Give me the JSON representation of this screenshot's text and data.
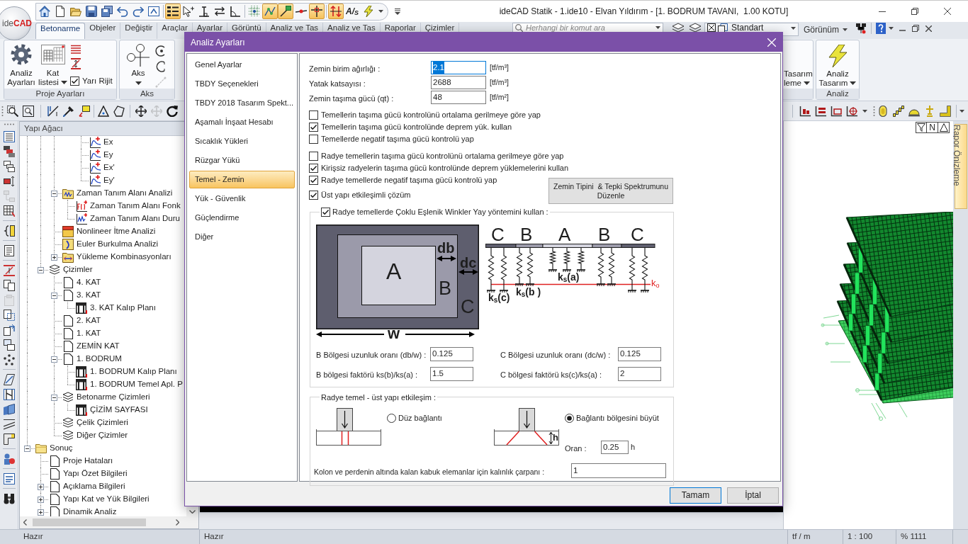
{
  "window": {
    "logo": "ide**CAD**",
    "title": "ideCAD Statik - 1.ide10 - Elvan Yıldırım - [1. BODRUM TAVANI,  1.00 KOTU]"
  },
  "quick_access_toolbar": [
    {
      "pressed": false
    },
    {
      "pressed": false
    },
    {
      "pressed": false
    },
    {
      "pressed": false
    },
    {
      "pressed": false
    },
    {
      "pressed": false
    },
    {
      "pressed": false
    },
    {
      "pressed": false
    },
    {
      "pressed": true
    },
    {
      "pressed": false
    },
    {
      "pressed": false
    },
    {
      "pressed": false
    },
    {
      "pressed": false
    },
    {
      "pressed": false
    },
    {
      "pressed": true
    },
    {
      "pressed": true
    },
    {
      "pressed": false
    },
    {
      "pressed": true
    },
    {
      "pressed": true
    },
    {
      "pressed": false,
      "label": "A/$_{S}$"
    },
    {
      "pressed": false
    }
  ],
  "ribbon": {
    "tabs": [
      {
        "label": "Betonarme",
        "selected": true
      },
      {
        "label": "Objeler",
        "selected": false
      },
      {
        "label": "Değiştir",
        "selected": false
      },
      {
        "label": "Araçlar",
        "selected": false
      },
      {
        "label": "Ayarlar",
        "selected": false
      },
      {
        "label": "Görüntü",
        "selected": false
      },
      {
        "label": "Analiz ve Tas",
        "selected": false
      },
      {
        "label": "Analiz ve Tas",
        "selected": false
      },
      {
        "label": "Raporlar",
        "selected": false
      },
      {
        "label": "Çizimler",
        "selected": false
      }
    ],
    "search": {
      "placeholder": "Herhangi bir komut ara"
    },
    "style_dropdown": "Standart",
    "view_dropdown": "Görünüm",
    "groups": [
      {
        "kind": "project",
        "label": "Proje Ayarları",
        "buttons": [
          {
            "label": "Analiz Ayarları",
            "dropdown": false
          },
          {
            "label": "Kat listesi",
            "dropdown": true
          }
        ],
        "options": [
          {
            "label": "Yarı Rijit",
            "checked": true
          }
        ]
      },
      {
        "kind": "axis",
        "label": "Aks",
        "buttons": [
          {
            "label": "Aks",
            "dropdown": true
          }
        ],
        "tools": [
          {
            "disabled": false
          },
          {
            "disabled": false
          },
          {
            "disabled": true
          }
        ]
      },
      {
        "kind": "partial",
        "buttons": [
          {
            "label": "Tasarım leme",
            "dropdown": true
          }
        ]
      },
      {
        "kind": "analysis",
        "label": "Analiz",
        "buttons": [
          {
            "label": "Analiz Tasarım",
            "dropdown": true
          }
        ]
      }
    ]
  },
  "view_toolbar": [
    {
      "disabled": false
    },
    {
      "disabled": false
    },
    {
      "disabled": false
    },
    {
      "disabled": false
    },
    {
      "disabled": false
    },
    {
      "disabled": false
    },
    {
      "disabled": false
    },
    {
      "disabled": false
    },
    {
      "disabled": true
    },
    {
      "disabled": false
    }
  ],
  "model_toolbar": [
    {
      "disabled": false
    },
    {
      "disabled": false
    },
    {
      "disabled": false
    },
    {
      "disabled": false
    },
    {
      "disabled": false
    },
    {
      "disabled": false
    },
    {
      "disabled": false
    },
    {
      "disabled": false
    },
    {
      "disabled": false
    }
  ],
  "side_toolbar": [
    {
      "disabled": false
    },
    {
      "disabled": false
    },
    {
      "disabled": false
    },
    {
      "disabled": false
    },
    {
      "disabled": true
    },
    {
      "disabled": false
    },
    {
      "disabled": false
    },
    {
      "disabled": false
    },
    {
      "disabled": false
    },
    {
      "disabled": false
    },
    {
      "disabled": true
    },
    {
      "disabled": false
    },
    {
      "disabled": false
    },
    {
      "disabled": false
    },
    {
      "disabled": false
    },
    {
      "disabled": false
    },
    {
      "disabled": false
    },
    {
      "disabled": false
    },
    {
      "disabled": false
    },
    {
      "disabled": false
    },
    {
      "disabled": false
    },
    {
      "disabled": false
    },
    {
      "disabled": false
    }
  ],
  "structure_tree": {
    "title": "Yapı Ağacı",
    "items": [
      {
        "children": [
          {
            "children": [
              {
                "children": [
                  {
                    "children": [
                      {
                        "label": "Ex",
                        "kind": "spectrum"
                      },
                      {
                        "label": "Ey",
                        "kind": "spectrum"
                      },
                      {
                        "label": "Ex'",
                        "kind": "spectrum"
                      },
                      {
                        "label": "Ey'",
                        "kind": "spectrum"
                      }
                    ]
                  }
                ]
              },
              {
                "label": "Zaman Tanım Alanı Analizi",
                "kind": "time-history",
                "expanded": true,
                "children": [
                  {
                    "label": "Zaman Tanım Alanı Fonk",
                    "kind": "function"
                  },
                  {
                    "label": "Zaman Tanım Alanı Duru",
                    "kind": "record"
                  }
                ]
              },
              {
                "label": "Nonlineer İtme Analizi",
                "kind": "pushover"
              },
              {
                "label": "Euler Burkulma Analizi",
                "kind": "buckling"
              },
              {
                "label": "Yükleme Kombinasyonları",
                "kind": "combination",
                "expanded": false
              }
            ]
          },
          {
            "label": "Çizimler",
            "kind": "drawings",
            "expanded": true,
            "children": [
              {
                "label": "4. KAT",
                "kind": "page"
              },
              {
                "label": "3. KAT",
                "kind": "page",
                "expanded": true,
                "children": [
                  {
                    "label": "3. KAT Kalıp Planı",
                    "kind": "sheet"
                  }
                ]
              },
              {
                "label": "2. KAT",
                "kind": "page"
              },
              {
                "label": "1. KAT",
                "kind": "page"
              },
              {
                "label": "ZEMİN KAT",
                "kind": "page"
              },
              {
                "label": "1. BODRUM",
                "kind": "page",
                "expanded": true,
                "children": [
                  {
                    "label": "1. BODRUM Kalıp Planı",
                    "kind": "sheet"
                  },
                  {
                    "label": "1. BODRUM Temel Apl. P",
                    "kind": "sheet"
                  }
                ]
              },
              {
                "label": "Betonarme Çizimleri",
                "kind": "drawings",
                "expanded": true,
                "children": [
                  {
                    "label": "ÇİZİM SAYFASI",
                    "kind": "sheet"
                  }
                ]
              },
              {
                "label": "Çelik Çizimleri",
                "kind": "drawings"
              },
              {
                "label": "Diğer Çizimler",
                "kind": "drawings"
              }
            ]
          }
        ]
      },
      {
        "label": "Sonuç",
        "kind": "folder",
        "expanded": true,
        "children": [
          {
            "label": "Proje Hataları",
            "kind": "page"
          },
          {
            "label": "Yapı Özet Bilgileri",
            "kind": "page"
          },
          {
            "label": "Açıklama Bilgileri",
            "kind": "page",
            "expanded": false
          },
          {
            "label": "Yapı Kat ve Yük Bilgileri",
            "kind": "page",
            "expanded": false
          },
          {
            "label": "Dinamik Analiz",
            "kind": "page",
            "expanded": false
          }
        ]
      }
    ]
  },
  "viewport": {
    "n_button": "N",
    "side_tab": "Rapor Önizleme"
  },
  "dialog": {
    "title": "Analiz Ayarları",
    "nav": [
      {
        "label": "Genel Ayarlar",
        "selected": false
      },
      {
        "label": "TBDY Seçenekleri",
        "selected": false
      },
      {
        "label": "TBDY 2018 Tasarım Spekt...",
        "selected": false
      },
      {
        "label": "Aşamalı İnşaat Hesabı",
        "selected": false
      },
      {
        "label": "Sıcaklık Yükleri",
        "selected": false
      },
      {
        "label": "Rüzgar Yükü",
        "selected": false
      },
      {
        "label": "Temel - Zemin",
        "selected": true
      },
      {
        "label": "Yük - Güvenlik",
        "selected": false
      },
      {
        "label": "Güçlendirme",
        "selected": false
      },
      {
        "label": "Diğer",
        "selected": false
      }
    ],
    "soil": [
      {
        "label": "Zemin birim ağırlığı :",
        "value": "2.1",
        "unit": "[tf/m³]",
        "focused": true
      },
      {
        "label": "Yatak katsayısı :",
        "value": "2688",
        "unit": "[tf/m³]",
        "focused": false
      },
      {
        "label": "Zemin taşıma gücü (qt) :",
        "value": "48",
        "unit": "[tf/m²]",
        "focused": false
      }
    ],
    "foundation_checks": [
      {
        "label": "Temellerin taşıma gücü kontrolünü ortalama gerilmeye göre yap",
        "checked": false
      },
      {
        "label": "Temellerin taşıma gücü kontrolünde deprem yük. kullan",
        "checked": true
      },
      {
        "label": "Temellerde negatif taşıma gücü kontrolü yap",
        "checked": false
      }
    ],
    "raft_checks": [
      {
        "label": "Radye temellerin taşıma gücü kontrolünü ortalama gerilmeye göre yap",
        "checked": false
      },
      {
        "label": "Kirişsiz radyelerin taşıma gücü kontrolünde deprem yüklemelerini kullan",
        "checked": true
      },
      {
        "label": "Radye temellerde negatif taşıma gücü kontrolü yap",
        "checked": true
      }
    ],
    "interaction_check": {
      "label": "Üst yapı etkileşimli çözüm",
      "checked": true
    },
    "spectrum_button": "Zemin Tipini  & Tepki Spektrumunu Düzenle",
    "winkler": {
      "label": "Radye temellerde Çoklu Eşlenik Winkler Yay yöntemini kullan :",
      "checked": true,
      "plan": {
        "zone_a": "A",
        "zone_b": "B",
        "zone_c": "C",
        "db": "db",
        "dc": "dc",
        "width": "w"
      },
      "springs": {
        "zones": [
          "C",
          "B",
          "A",
          "B",
          "C"
        ],
        "ks_c": "k$_{s}$(c)",
        "ks_b": "k$_{s}$(b )",
        "ks_a": "k$_{s}$(a)",
        "k0": "k$_{o}$"
      },
      "fields": [
        {
          "label": "B Bölgesi uzunluk oranı (db/w) :",
          "value": "0.125"
        },
        {
          "label": "C Bölgesi uzunluk oranı (dc/w) :",
          "value": "0.125"
        },
        {
          "label": "B bölgesi faktörü ks(b)/ks(a) :",
          "value": "1.5"
        },
        {
          "label": "C bölgesi faktörü ks(c)/ks(a) :",
          "value": "2"
        }
      ]
    },
    "interaction": {
      "label": "Radye temel - üst yapı etkileşim :",
      "options": [
        {
          "label": "Düz bağlantı",
          "selected": false
        },
        {
          "label": "Bağlantı bölgesini büyüt",
          "selected": true
        }
      ],
      "height_label": "h",
      "ratio": {
        "label": "Oran :",
        "value": "0.25",
        "unit": "h"
      },
      "thickness": {
        "label": "Kolon ve perdenin altında kalan kabuk elemanlar için kalınlık çarpanı :",
        "value": "1"
      }
    },
    "buttons": [
      {
        "label": "Tamam",
        "default": true
      },
      {
        "label": "İptal",
        "default": false
      }
    ]
  },
  "status_bar": [
    "Hazır",
    "Hazır",
    "tf / m",
    "1 : 100",
    "% 1111"
  ]
}
